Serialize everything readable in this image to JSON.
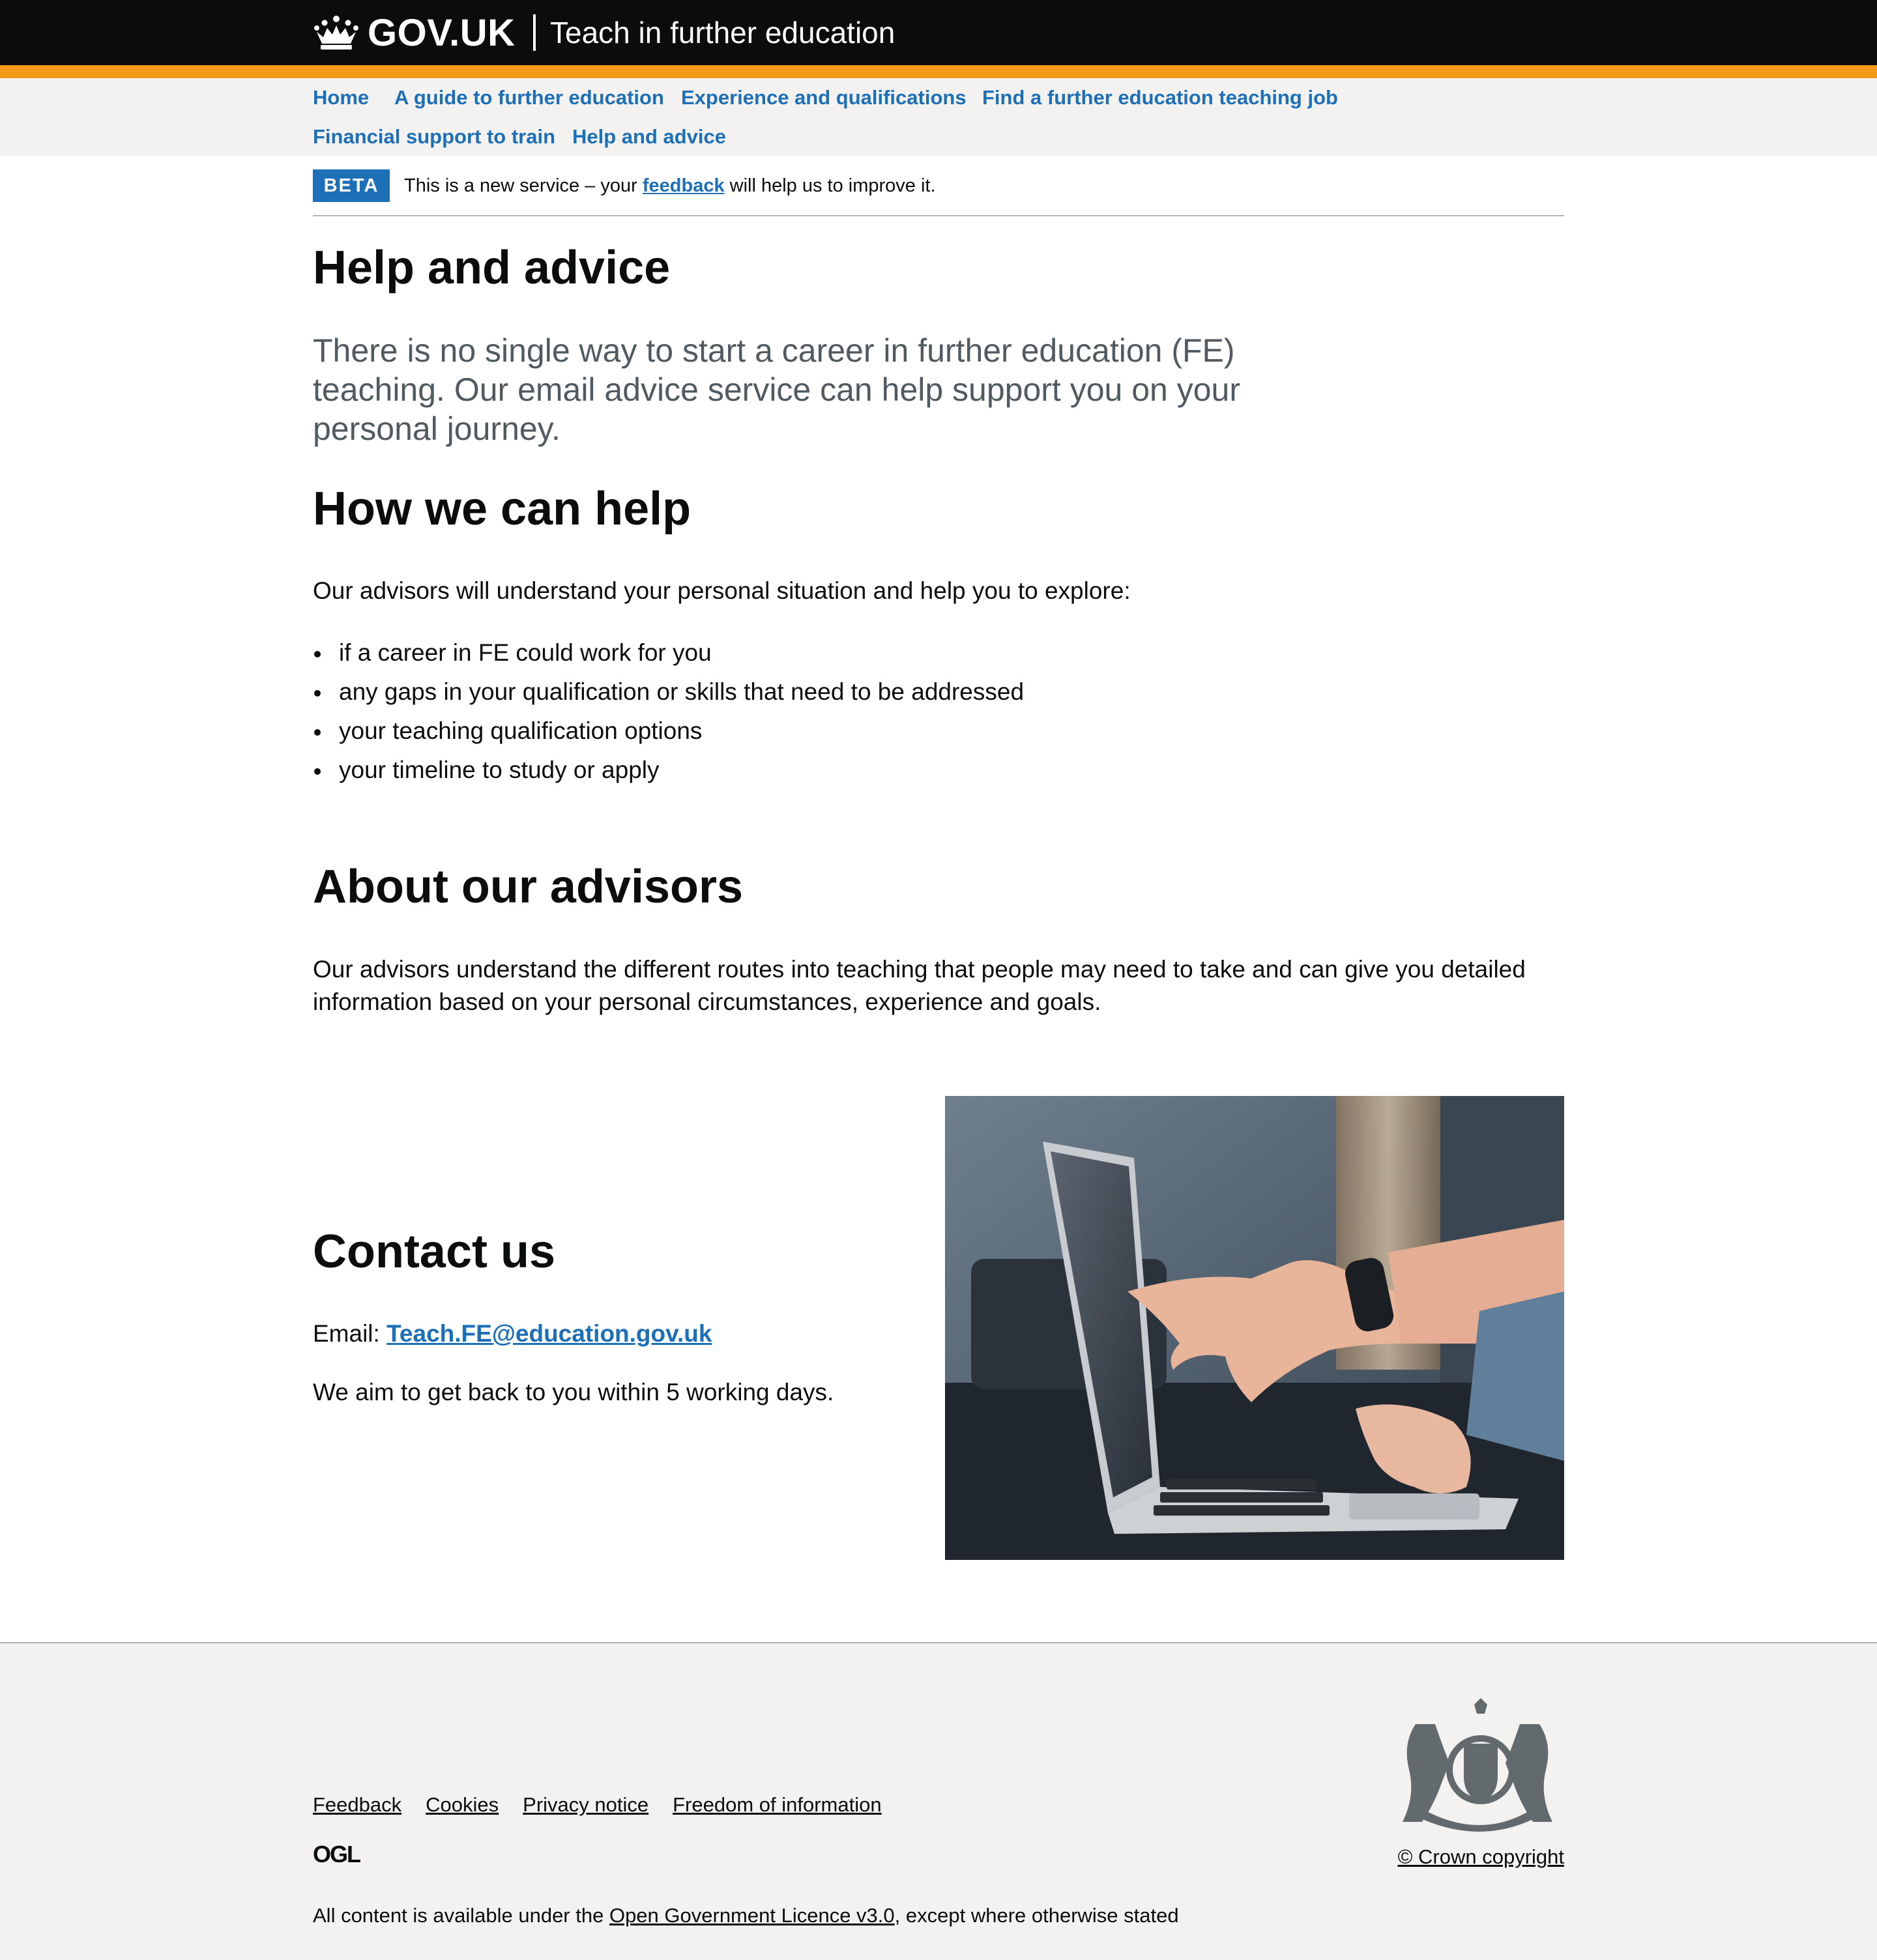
{
  "header": {
    "logo_text": "GOV.UK",
    "service_name": "Teach in further education"
  },
  "nav": {
    "items": [
      {
        "label": "Home"
      },
      {
        "label": "A guide to further education"
      },
      {
        "label": "Experience and qualifications"
      },
      {
        "label": "Find a further education teaching job"
      },
      {
        "label": "Financial support to train"
      },
      {
        "label": "Help and advice"
      }
    ]
  },
  "beta": {
    "tag": "BETA",
    "text_before": "This is a new service – your ",
    "link": "feedback",
    "text_after": " will help us to improve it."
  },
  "main": {
    "title": "Help and advice",
    "lead": "There is no single way to start a career in further education (FE) teaching. Our email advice service can help support you on your personal journey.",
    "how_heading": "How we can help",
    "how_intro": "Our advisors will understand your personal situation and help you to explore:",
    "how_bullets": [
      "if a career in FE could work for you",
      "any gaps in your qualification or skills that need to be addressed",
      "your teaching qualification options",
      "your timeline to study or apply"
    ],
    "about_heading": "About our advisors",
    "about_text": "Our advisors understand the different routes into teaching that people may need to take and can give you detailed information based on your personal circumstances, experience and goals.",
    "contact_heading": "Contact us",
    "email_label": "Email: ",
    "email": "Teach.FE@education.gov.uk",
    "response_time": "We aim to get back to you within 5 working days.",
    "image_icon": "laptop-photo"
  },
  "footer": {
    "links": [
      "Feedback",
      "Cookies",
      "Privacy notice",
      "Freedom of information"
    ],
    "ogl_label": "OGL",
    "licence_before": "All content is available under the ",
    "licence_link": "Open Government Licence v3.0",
    "licence_after": ", except where otherwise stated",
    "copyright": "© Crown copyright"
  },
  "colors": {
    "header": "#0b0c0c",
    "stripe": "#f59b1a",
    "link": "#1d70b8",
    "nav_bg": "#f3f2f1",
    "lead_text": "#505a5f"
  }
}
